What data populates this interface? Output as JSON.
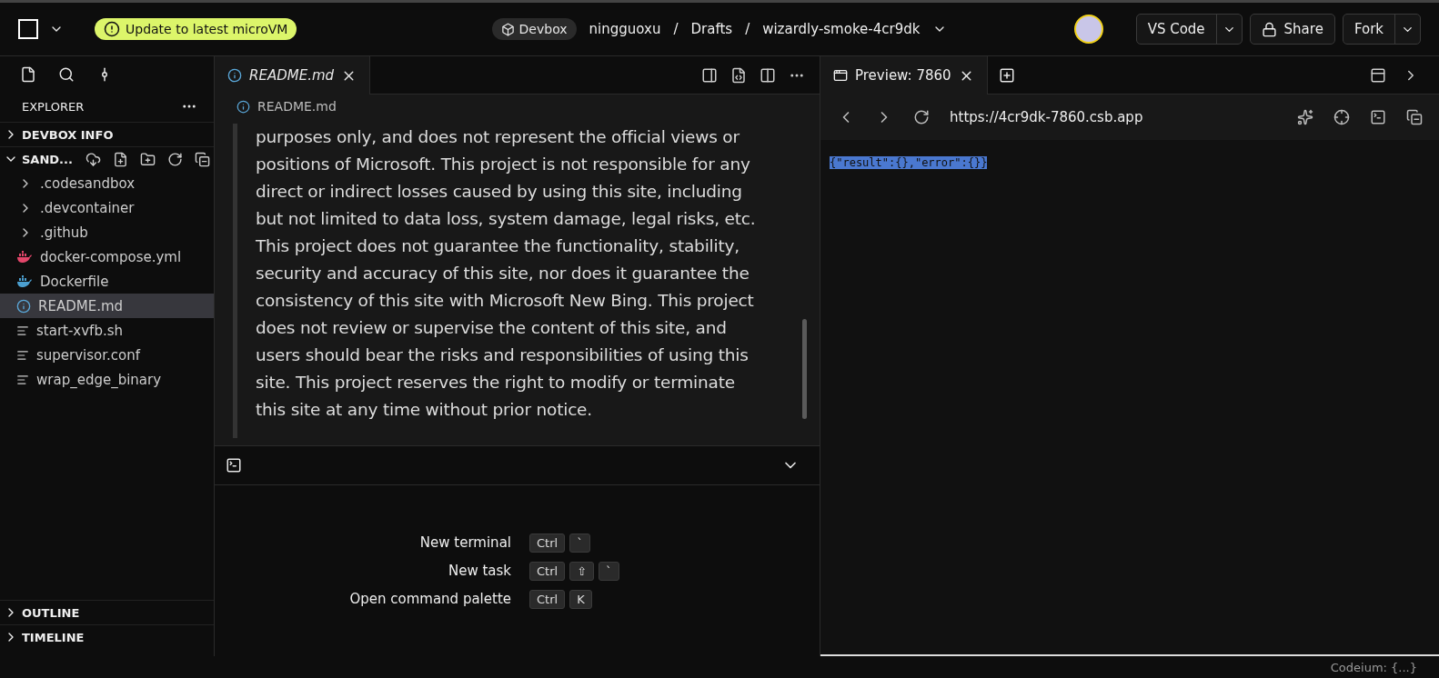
{
  "header": {
    "update_badge": "Update to latest microVM",
    "devbox_chip": "Devbox",
    "breadcrumb": [
      "ningguoxu",
      "Drafts",
      "wizardly-smoke-4cr9dk"
    ],
    "breadcrumb_separator": "/",
    "buttons": [
      {
        "label": "VS Code",
        "dropdown": true
      },
      {
        "label": "Share",
        "kind": "lock"
      },
      {
        "label": "Fork",
        "dropdown": true
      }
    ]
  },
  "sidebar": {
    "title": "EXPLORER",
    "sections": [
      {
        "label": "DEVBOX INFO",
        "expanded": false
      },
      {
        "label": "SAND...",
        "expanded": true,
        "items": [
          {
            "label": ".codesandbox",
            "kind": "folder",
            "selected": false
          },
          {
            "label": ".devcontainer",
            "kind": "folder",
            "selected": false
          },
          {
            "label": ".github",
            "kind": "folder",
            "selected": false
          },
          {
            "label": "docker-compose.yml",
            "kind": "docker",
            "color": "#e2466a",
            "selected": false
          },
          {
            "label": "Dockerfile",
            "kind": "docker",
            "color": "#4b9fd0",
            "selected": false
          },
          {
            "label": "README.md",
            "kind": "info",
            "selected": true
          },
          {
            "label": "start-xvfb.sh",
            "kind": "text",
            "selected": false
          },
          {
            "label": "supervisor.conf",
            "kind": "text",
            "selected": false
          },
          {
            "label": "wrap_edge_binary",
            "kind": "text",
            "selected": false
          }
        ]
      }
    ],
    "bottom_sections": [
      {
        "label": "OUTLINE",
        "expanded": false
      },
      {
        "label": "TIMELINE",
        "expanded": false
      }
    ]
  },
  "editor": {
    "tabs": [
      {
        "label": "README.md",
        "selected": true
      }
    ],
    "breadcrumb": "README.md",
    "lines": [
      "purposes only, and does not represent the official views or",
      "positions of Microsoft. This project is not responsible for any",
      "direct or indirect losses caused by using this site, including",
      "but not limited to data loss, system damage, legal risks, etc.",
      "This project does not guarantee the functionality, stability,",
      "security and accuracy of this site, nor does it guarantee the",
      "consistency of this site with Microsoft New Bing. This project",
      "does not review or supervise the content of this site, and",
      "users should bear the risks and responsibilities of using this",
      "site. This project reserves the right to modify or terminate",
      "this site at any time without prior notice."
    ]
  },
  "terminal_panel": {
    "shortcuts": [
      {
        "label": "New terminal",
        "keys": [
          "Ctrl",
          "`"
        ]
      },
      {
        "label": "New task",
        "keys": [
          "Ctrl",
          "⇧",
          "`"
        ]
      },
      {
        "label": "Open command palette",
        "keys": [
          "Ctrl",
          "K"
        ]
      }
    ]
  },
  "preview": {
    "tab": {
      "label": "Preview: 7860",
      "selected": true
    },
    "url": "https://4cr9dk-7860.csb.app",
    "body": {
      "text": "{\"result\":{},\"error\":{}}",
      "selected": true
    }
  },
  "status_bar": {
    "text": "Codeium: {...}"
  }
}
